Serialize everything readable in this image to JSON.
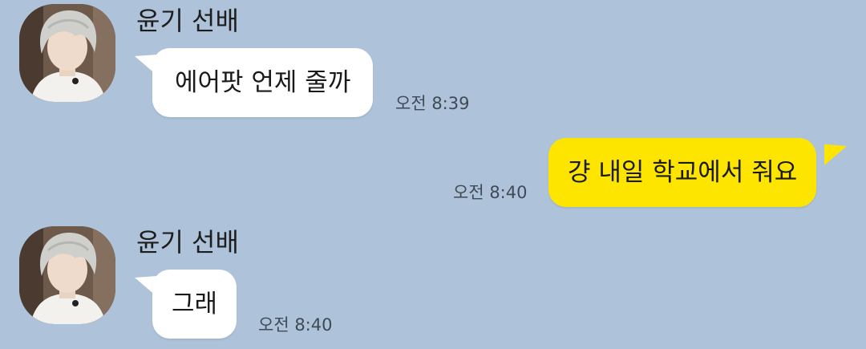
{
  "colors": {
    "background": "#aec3d9",
    "incoming_bubble": "#ffffff",
    "outgoing_bubble": "#fee500"
  },
  "messages": [
    {
      "sender": "윤기 선배",
      "direction": "incoming",
      "text": "에어팟 언제 줄까",
      "time": "오전 8:39",
      "avatar_icon": "profile-photo-icon"
    },
    {
      "direction": "outgoing",
      "text": "걍 내일 학교에서 줘요",
      "time": "오전 8:40"
    },
    {
      "sender": "윤기 선배",
      "direction": "incoming",
      "text": "그래",
      "time": "오전 8:40",
      "avatar_icon": "profile-photo-icon"
    }
  ]
}
